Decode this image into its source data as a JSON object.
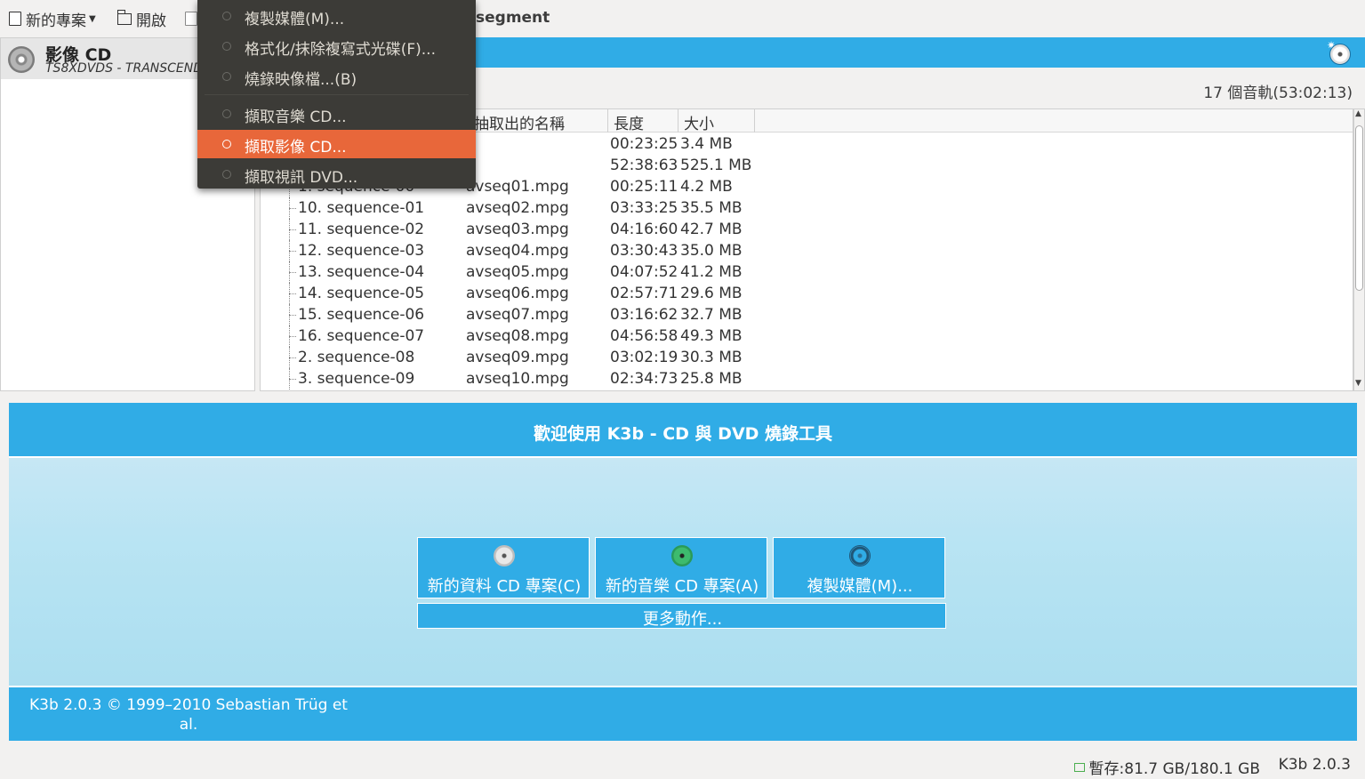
{
  "toolbar": {
    "new_project": "新的專案",
    "open": "開啟",
    "title_fragment": "segment"
  },
  "device": {
    "title": "影像 CD",
    "subtitle": "TS8XDVDS - TRANSCEND"
  },
  "tracks_info": {
    "count_label": "17 個音軌(53:02:13)"
  },
  "list": {
    "columns": [
      "抽取出的名稱",
      "長度",
      "大小"
    ],
    "rows": [
      {
        "name": "",
        "file": "",
        "length": "00:23:25",
        "size": "3.4 MB"
      },
      {
        "name": "",
        "file": "",
        "length": "52:38:63",
        "size": "525.1 MB"
      },
      {
        "name": "1. sequence-00",
        "file": "avseq01.mpg",
        "length": "00:25:11",
        "size": "4.2 MB"
      },
      {
        "name": "10. sequence-01",
        "file": "avseq02.mpg",
        "length": "03:33:25",
        "size": "35.5 MB"
      },
      {
        "name": "11. sequence-02",
        "file": "avseq03.mpg",
        "length": "04:16:60",
        "size": "42.7 MB"
      },
      {
        "name": "12. sequence-03",
        "file": "avseq04.mpg",
        "length": "03:30:43",
        "size": "35.0 MB"
      },
      {
        "name": "13. sequence-04",
        "file": "avseq05.mpg",
        "length": "04:07:52",
        "size": "41.2 MB"
      },
      {
        "name": "14. sequence-05",
        "file": "avseq06.mpg",
        "length": "02:57:71",
        "size": "29.6 MB"
      },
      {
        "name": "15. sequence-06",
        "file": "avseq07.mpg",
        "length": "03:16:62",
        "size": "32.7 MB"
      },
      {
        "name": "16. sequence-07",
        "file": "avseq08.mpg",
        "length": "04:56:58",
        "size": "49.3 MB"
      },
      {
        "name": "2. sequence-08",
        "file": "avseq09.mpg",
        "length": "03:02:19",
        "size": "30.3 MB"
      },
      {
        "name": "3. sequence-09",
        "file": "avseq10.mpg",
        "length": "02:34:73",
        "size": "25.8 MB"
      }
    ]
  },
  "welcome": {
    "title": "歡迎使用 K3b - CD 與 DVD 燒錄工具",
    "actions": [
      {
        "label": "新的資料 CD 專案(C)",
        "icon": "data-cd-icon"
      },
      {
        "label": "新的音樂 CD 專案(A)",
        "icon": "audio-cd-icon"
      },
      {
        "label": "複製媒體(M)...",
        "icon": "copy-media-icon"
      }
    ],
    "more": "更多動作...",
    "footer": "K3b 2.0.3 © 1999–2010 Sebastian Trüg et al."
  },
  "statusbar": {
    "temp": "暫存:81.7 GB/180.1 GB",
    "version": "K3b 2.0.3"
  },
  "menu": {
    "items": [
      {
        "label": "複製媒體(M)..."
      },
      {
        "label": "格式化/抹除複寫式光碟(F)..."
      },
      {
        "label": "燒錄映像檔...(B)"
      },
      {
        "label": "擷取音樂 CD..."
      },
      {
        "label": "擷取影像 CD..."
      },
      {
        "label": "擷取視訊 DVD..."
      }
    ],
    "active_index": 4
  },
  "colors": {
    "accent": "#30ace6",
    "menu_bg": "#3c3b37",
    "menu_highlight": "#e8673a"
  }
}
